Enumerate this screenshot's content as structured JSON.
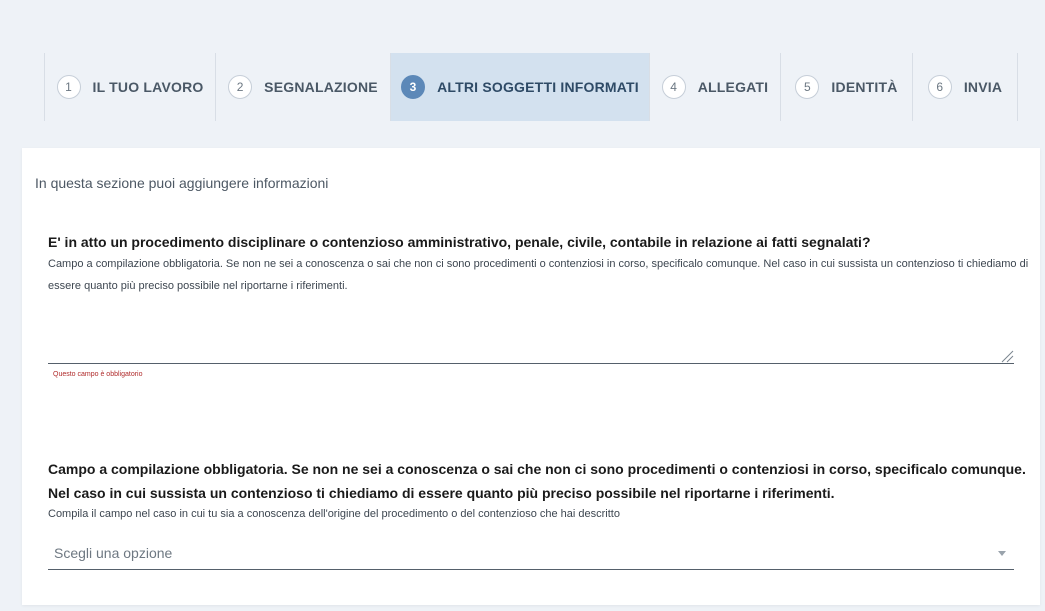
{
  "stepper": {
    "steps": [
      {
        "number": "1",
        "label": "IL TUO LAVORO",
        "active": false
      },
      {
        "number": "2",
        "label": "SEGNALAZIONE",
        "active": false
      },
      {
        "number": "3",
        "label": "ALTRI SOGGETTI INFORMATI",
        "active": true
      },
      {
        "number": "4",
        "label": "ALLEGATI",
        "active": false
      },
      {
        "number": "5",
        "label": "IDENTITÀ",
        "active": false
      },
      {
        "number": "6",
        "label": "INVIA",
        "active": false
      }
    ]
  },
  "form": {
    "intro": "In questa sezione puoi aggiungere informazioni",
    "question1": {
      "title": "E' in atto un procedimento disciplinare o contenzioso amministrativo, penale, civile, contabile in relazione ai fatti segnalati?",
      "help": "Campo a compilazione obbligatoria. Se non ne sei a conoscenza o sai che non ci sono procedimenti o contenziosi in corso, specificalo comunque. Nel caso in cui sussista un contenzioso ti chiediamo di essere quanto più preciso possibile nel riportarne i riferimenti.",
      "value": "",
      "error": "Questo campo è obbligatorio"
    },
    "question2": {
      "title": "Campo a compilazione obbligatoria. Se non ne sei a conoscenza o sai che non ci sono procedimenti o contenziosi in corso, specificalo comunque. Nel caso in cui sussista un contenzioso ti chiediamo di essere quanto più preciso possibile nel riportarne i riferimenti.",
      "help": "Compila il campo nel caso in cui tu sia a conoscenza dell'origine del procedimento o del contenzioso che hai descritto",
      "placeholder": "Scegli una opzione"
    }
  }
}
